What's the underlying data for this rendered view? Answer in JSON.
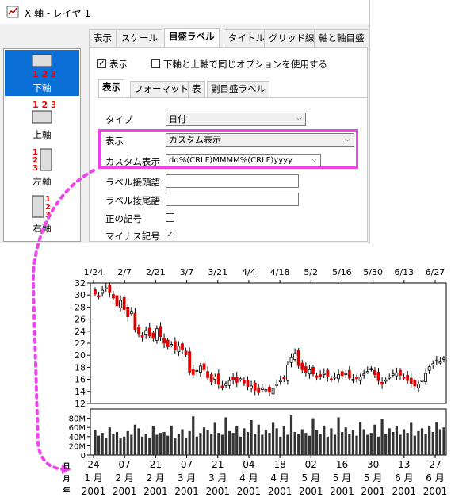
{
  "window": {
    "title": "X 軸 - レイヤ 1"
  },
  "tabs": [
    "表示",
    "スケール",
    "目盛ラベル",
    "タイトル",
    "グリッド線",
    "軸と軸目盛"
  ],
  "active_tab": "目盛ラベル",
  "side_items": [
    {
      "label": "下軸",
      "icon_text": "123",
      "selected": true
    },
    {
      "label": "上軸",
      "icon_text": "123",
      "selected": false
    },
    {
      "label": "左軸",
      "icon_text": "123",
      "selected": false
    },
    {
      "label": "右軸",
      "icon_text": "123",
      "selected": false
    }
  ],
  "show_checkbox": {
    "label": "表示",
    "checked": true
  },
  "same_option_checkbox": {
    "label": "下軸と上軸で同じオプションを使用する",
    "checked": false
  },
  "subtabs": [
    "表示",
    "フォーマット",
    "表",
    "副目盛ラベル"
  ],
  "form": {
    "type_label": "タイプ",
    "type_value": "日付",
    "display_label": "表示",
    "display_value": "カスタム表示",
    "custom_label": "カスタム表示",
    "custom_value": "dd%(CRLF)MMMM%(CRLF)yyyy",
    "prefix_label": "ラベル接頭語",
    "prefix_value": "",
    "suffix_label": "ラベル接尾語",
    "suffix_value": "",
    "plus_label": "正の記号",
    "plus_checked": false,
    "minus_label": "マイナス記号",
    "minus_checked": true
  },
  "chart_data": {
    "type": "candlestick",
    "top_tick_labels": [
      "1/24",
      "2/7",
      "2/21",
      "3/7",
      "3/21",
      "4/4",
      "4/18",
      "5/2",
      "5/16",
      "5/30",
      "6/13",
      "6/27"
    ],
    "bottom_day_labels": [
      "24",
      "07",
      "21",
      "07",
      "21",
      "04",
      "18",
      "02",
      "16",
      "30",
      "13",
      "27"
    ],
    "bottom_month_labels": [
      "1 月",
      "2 月",
      "2 月",
      "3 月",
      "3 月",
      "4 月",
      "4 月",
      "5 月",
      "5 月",
      "5 月",
      "6 月",
      "6 月"
    ],
    "bottom_year_labels": [
      "2001",
      "2001",
      "2001",
      "2001",
      "2001",
      "2001",
      "2001",
      "2001",
      "2001",
      "2001",
      "2001",
      "2001"
    ],
    "side_axis_labels": [
      "日",
      "月",
      "年"
    ],
    "price_ylim": [
      12,
      32
    ],
    "price_ticks": [
      "32",
      "30",
      "28",
      "26",
      "24",
      "22",
      "20",
      "18",
      "16",
      "14",
      "12"
    ],
    "volume_ticks": [
      "80M",
      "60M",
      "40M",
      "20M",
      "0"
    ],
    "price_close": [
      30.2,
      29.8,
      30.8,
      31.2,
      30.4,
      29.5,
      28.2,
      29.1,
      27.6,
      26.4,
      27.3,
      24.3,
      23.6,
      23.0,
      24.1,
      23.2,
      22.8,
      24.4,
      23.1,
      22.0,
      21.4,
      21.8,
      20.9,
      21.5,
      21.0,
      20.1,
      17.2,
      16.8,
      17.5,
      18.2,
      17.6,
      16.3,
      15.6,
      16.4,
      15.2,
      14.6,
      15.3,
      15.8,
      16.0,
      15.5,
      16.1,
      15.4,
      14.8,
      14.9,
      14.2,
      13.8,
      14.6,
      14.3,
      13.9,
      14.5,
      15.2,
      15.8,
      16.1,
      18.4,
      19.6,
      20.3,
      18.3,
      17.6,
      17.2,
      17.6,
      16.9,
      16.3,
      16.5,
      17.0,
      16.4,
      15.9,
      16.4,
      16.8,
      16.6,
      17.0,
      16.2,
      16.0,
      16.1,
      16.4,
      16.9,
      17.3,
      17.8,
      16.8,
      15.8,
      15.2,
      15.9,
      16.4,
      16.9,
      17.1,
      16.7,
      16.2,
      15.8,
      15.3,
      14.9,
      15.2,
      15.9,
      17.0,
      18.1,
      18.6,
      19.2,
      18.9,
      19.5
    ],
    "volume": [
      55,
      42,
      48,
      38,
      60,
      45,
      50,
      36,
      40,
      52,
      44,
      66,
      58,
      40,
      46,
      38,
      62,
      44,
      48,
      50,
      42,
      64,
      36,
      46,
      56,
      38,
      52,
      84,
      40,
      48,
      60,
      54,
      46,
      70,
      48,
      44,
      82,
      52,
      48,
      62,
      40,
      58,
      50,
      76,
      46,
      66,
      44,
      54,
      48,
      70,
      58,
      40,
      62,
      44,
      86,
      50,
      46,
      56,
      48,
      42,
      80,
      54,
      46,
      64,
      40,
      58,
      44,
      82,
      50,
      60,
      46,
      54,
      42,
      72,
      56,
      44,
      48,
      66,
      40,
      78,
      46,
      58,
      50,
      62,
      44,
      56,
      48,
      70,
      42,
      52,
      58,
      46,
      64,
      50,
      72,
      56,
      60
    ]
  }
}
